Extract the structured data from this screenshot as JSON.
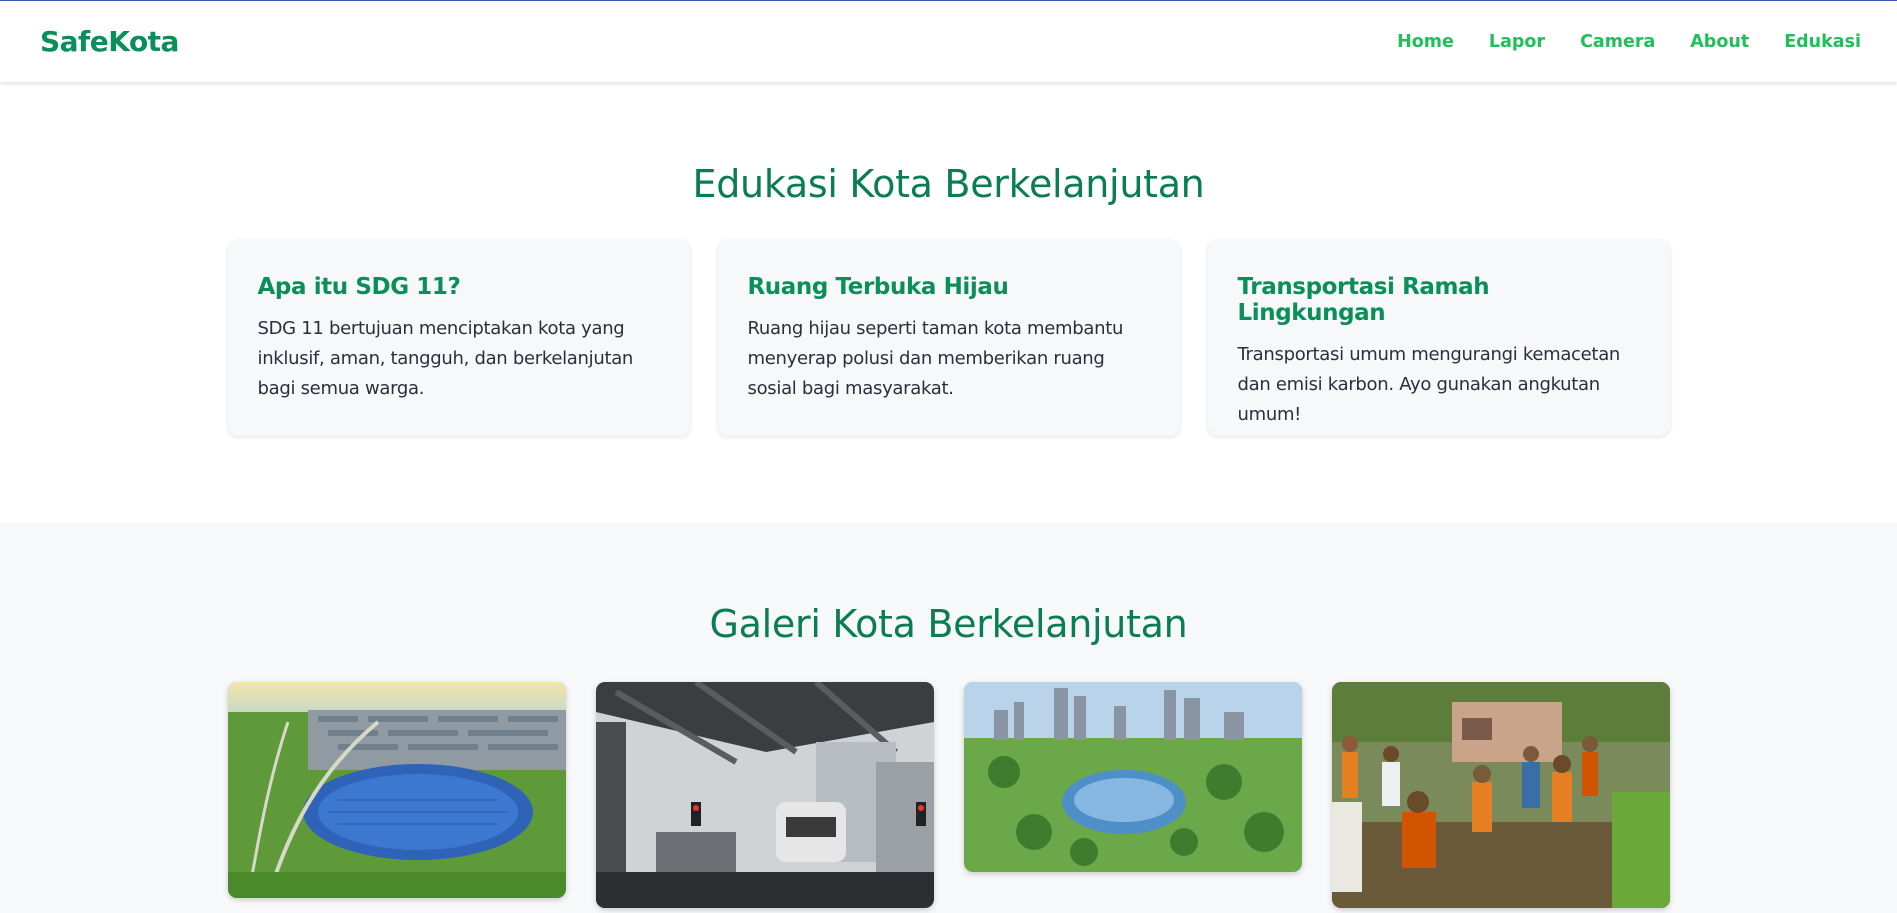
{
  "nav": {
    "brand": "SafeKota",
    "links": [
      "Home",
      "Lapor",
      "Camera",
      "About",
      "Edukasi"
    ]
  },
  "edukasi": {
    "title": "Edukasi Kota Berkelanjutan",
    "cards": [
      {
        "title": "Apa itu SDG 11?",
        "text": "SDG 11 bertujuan menciptakan kota yang inklusif, aman, tangguh, dan berkelanjutan bagi semua warga."
      },
      {
        "title": "Ruang Terbuka Hijau",
        "text": "Ruang hijau seperti taman kota membantu menyerap polusi dan memberikan ruang sosial bagi masyarakat."
      },
      {
        "title": "Transportasi Ramah Lingkungan",
        "text": "Transportasi umum mengurangi kemacetan dan emisi karbon. Ayo gunakan angkutan umum!"
      }
    ]
  },
  "galeri": {
    "title": "Galeri Kota Berkelanjutan",
    "images": [
      "solar-farm-aerial-photo",
      "metro-train-station-photo",
      "city-park-skyline-photo",
      "community-cleanup-photo"
    ]
  }
}
